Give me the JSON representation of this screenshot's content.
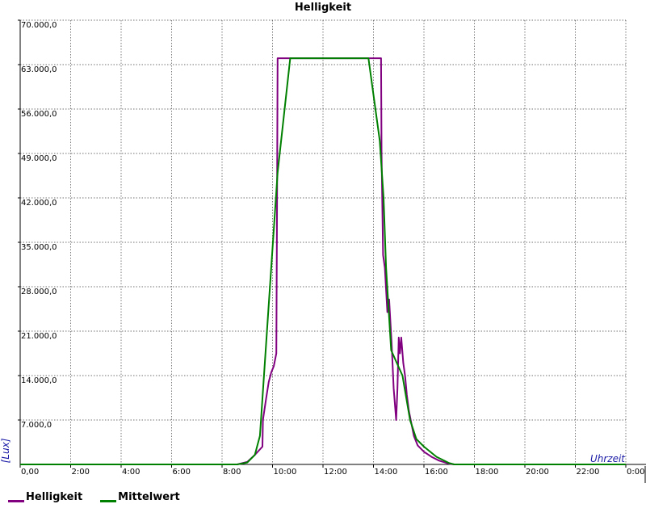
{
  "chart_data": {
    "type": "line",
    "title": "Helligkeit",
    "xlabel": "Uhrzeit",
    "ylabel": "[Lux]",
    "xlim": [
      0,
      24
    ],
    "ylim": [
      0,
      70000
    ],
    "x_ticks": [
      0,
      2,
      4,
      6,
      8,
      10,
      12,
      14,
      16,
      18,
      20,
      22,
      24
    ],
    "x_tick_labels": [
      "0,00",
      "2:00",
      "4:00",
      "6:00",
      "8:00",
      "10:00",
      "12:00",
      "14:00",
      "16:00",
      "18:00",
      "20:00",
      "22:00",
      "0:00"
    ],
    "y_ticks": [
      7000,
      14000,
      21000,
      28000,
      35000,
      42000,
      49000,
      56000,
      63000,
      70000
    ],
    "y_tick_labels": [
      "7.000,0",
      "14.000,0",
      "21.000,0",
      "28.000,0",
      "35.000,0",
      "42.000,0",
      "49.000,0",
      "56.000,0",
      "63.000,0",
      "70.000,0"
    ],
    "grid": true,
    "legend_position": "bottom-left",
    "series": [
      {
        "name": "Helligkeit",
        "color": "#800080",
        "points": [
          [
            0,
            0
          ],
          [
            8.6,
            0
          ],
          [
            9.0,
            400
          ],
          [
            9.3,
            1500
          ],
          [
            9.6,
            2800
          ],
          [
            9.62,
            7000
          ],
          [
            9.75,
            10500
          ],
          [
            9.85,
            13000
          ],
          [
            9.95,
            14500
          ],
          [
            10.05,
            15500
          ],
          [
            10.15,
            17500
          ],
          [
            10.18,
            41500
          ],
          [
            10.2,
            64000
          ],
          [
            14.3,
            64000
          ],
          [
            14.32,
            49000
          ],
          [
            14.38,
            33000
          ],
          [
            14.45,
            31000
          ],
          [
            14.55,
            24000
          ],
          [
            14.62,
            26000
          ],
          [
            14.72,
            19000
          ],
          [
            14.8,
            12000
          ],
          [
            14.9,
            7000
          ],
          [
            14.95,
            12000
          ],
          [
            15.0,
            20000
          ],
          [
            15.05,
            17500
          ],
          [
            15.1,
            20000
          ],
          [
            15.18,
            16000
          ],
          [
            15.25,
            14000
          ],
          [
            15.32,
            11000
          ],
          [
            15.4,
            8500
          ],
          [
            15.5,
            6500
          ],
          [
            15.6,
            4500
          ],
          [
            15.75,
            3000
          ],
          [
            16.0,
            2000
          ],
          [
            16.3,
            1200
          ],
          [
            16.6,
            600
          ],
          [
            17.0,
            100
          ],
          [
            17.2,
            0
          ],
          [
            23.95,
            0
          ]
        ]
      },
      {
        "name": "Mittelwert",
        "color": "#008000",
        "points": [
          [
            0,
            0
          ],
          [
            8.6,
            0
          ],
          [
            9.0,
            300
          ],
          [
            9.3,
            1500
          ],
          [
            9.5,
            4500
          ],
          [
            10.2,
            46000
          ],
          [
            10.7,
            64000
          ],
          [
            13.8,
            64000
          ],
          [
            14.25,
            51000
          ],
          [
            14.4,
            42000
          ],
          [
            14.5,
            31000
          ],
          [
            14.7,
            18000
          ],
          [
            15.15,
            14000
          ],
          [
            15.3,
            10500
          ],
          [
            15.45,
            7000
          ],
          [
            15.7,
            4000
          ],
          [
            16.0,
            2800
          ],
          [
            16.5,
            1200
          ],
          [
            17.0,
            200
          ],
          [
            17.2,
            0
          ],
          [
            24,
            0
          ]
        ]
      }
    ]
  }
}
